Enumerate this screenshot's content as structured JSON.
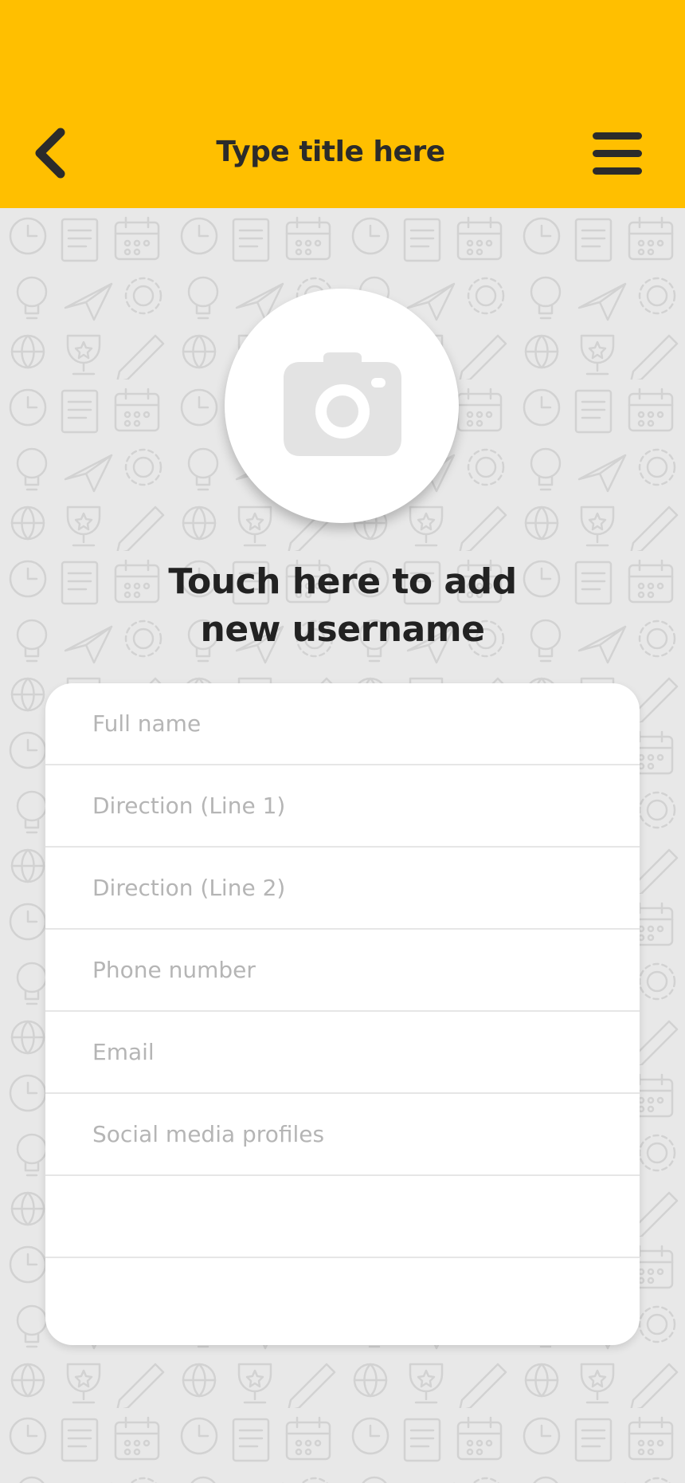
{
  "header": {
    "title": "Type title here",
    "background": "#ffbf00",
    "back_icon": "chevron-left-icon",
    "menu_icon": "hamburger-menu-icon"
  },
  "avatar": {
    "icon": "camera-icon",
    "prompt_line1": "Touch here to add",
    "prompt_line2": "new username"
  },
  "form": {
    "fields": [
      {
        "placeholder": "Full name",
        "value": ""
      },
      {
        "placeholder": "Direction (Line 1)",
        "value": ""
      },
      {
        "placeholder": "Direction (Line 2)",
        "value": ""
      },
      {
        "placeholder": "Phone number",
        "value": ""
      },
      {
        "placeholder": "Email",
        "value": ""
      },
      {
        "placeholder": "Social media profiles",
        "value": ""
      },
      {
        "placeholder": "",
        "value": ""
      },
      {
        "placeholder": "",
        "value": ""
      }
    ]
  },
  "background_pattern": "school-doodles-pattern"
}
